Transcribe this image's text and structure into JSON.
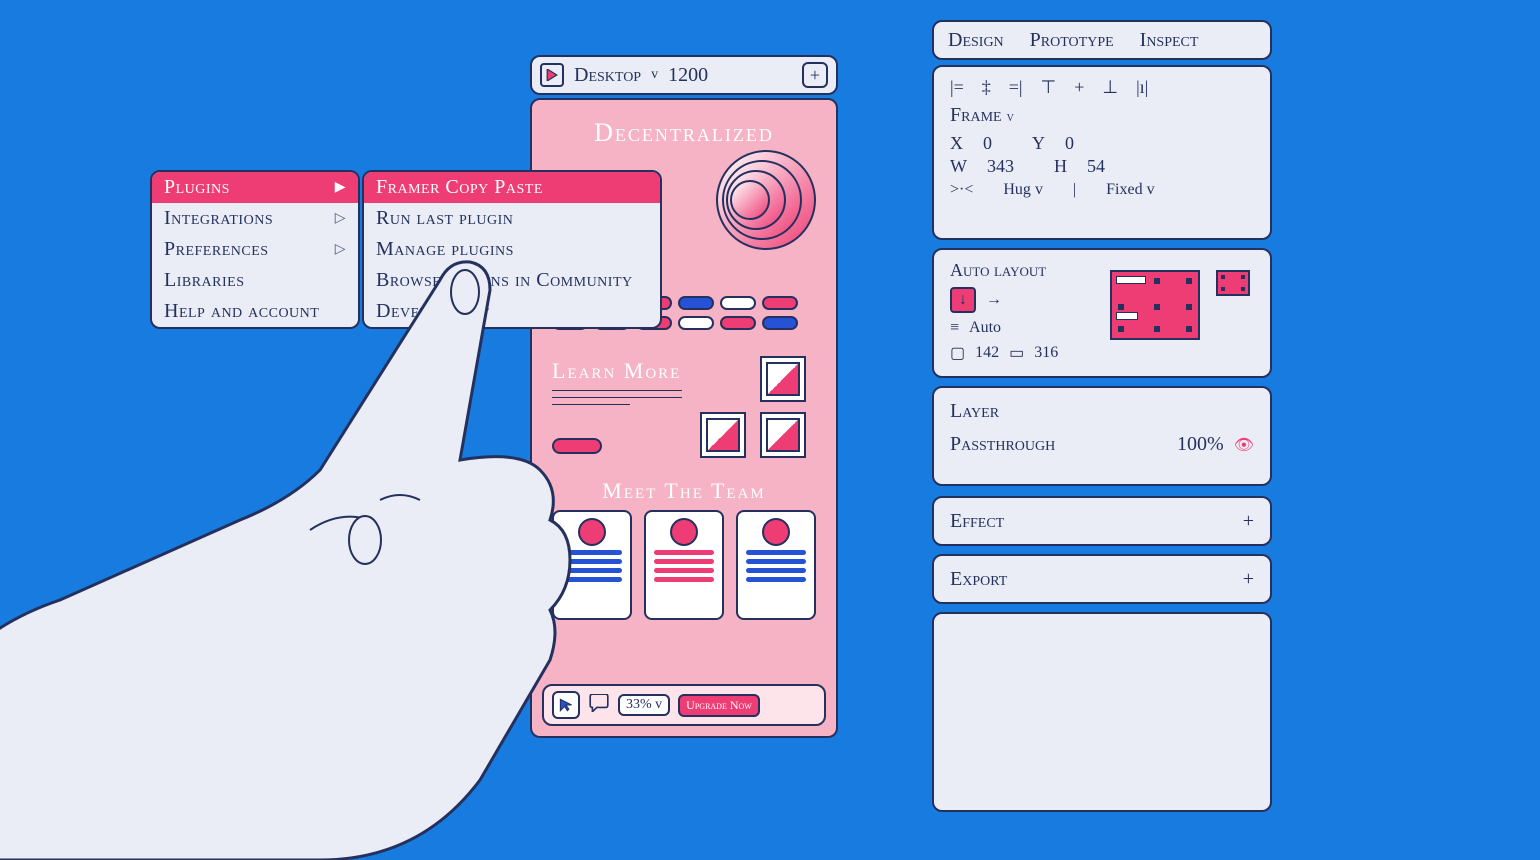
{
  "menu1": {
    "items": [
      {
        "label": "Plugins",
        "hasSubmenu": true,
        "active": true
      },
      {
        "label": "Integrations",
        "hasSubmenu": true
      },
      {
        "label": "Preferences",
        "hasSubmenu": true
      },
      {
        "label": "Libraries"
      },
      {
        "label": "Help and account"
      }
    ]
  },
  "menu2": {
    "items": [
      {
        "label": "Framer Copy Paste",
        "active": true
      },
      {
        "label": "Run last plugin"
      },
      {
        "label": "Manage plugins"
      },
      {
        "label": "Browse plugins in Community"
      },
      {
        "label": "Development"
      }
    ]
  },
  "canvas_header": {
    "device": "Desktop",
    "width": "1200"
  },
  "canvas": {
    "section1": "Decentralized",
    "section2": "Learn More",
    "section3": "Meet The Team",
    "zoom": "33%",
    "upgrade": "Upgrade Now"
  },
  "tabs": [
    "Design",
    "Prototype",
    "Inspect"
  ],
  "frame": {
    "label": "Frame",
    "x_label": "X",
    "x": "0",
    "y_label": "Y",
    "y": "0",
    "w_label": "W",
    "w": "343",
    "h_label": "H",
    "h": "54",
    "hug": "Hug",
    "fixed": "Fixed"
  },
  "autolayout": {
    "title": "Auto layout",
    "mode": "Auto",
    "val1": "142",
    "val2": "316"
  },
  "layer": {
    "title": "Layer",
    "mode": "Passthrough",
    "opacity": "100%"
  },
  "effect": {
    "title": "Effect"
  },
  "export": {
    "title": "Export"
  }
}
